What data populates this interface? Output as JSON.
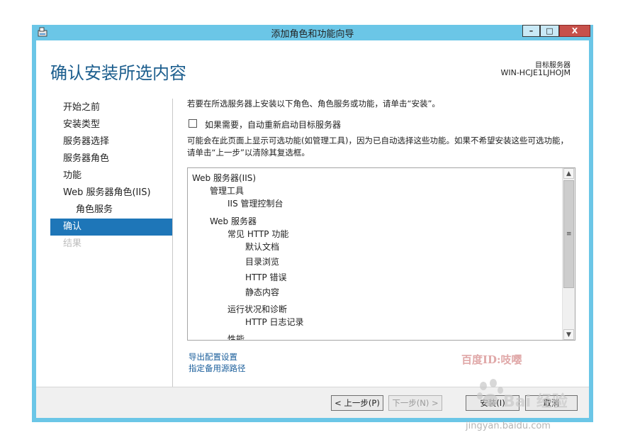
{
  "window": {
    "title": "添加角色和功能向导",
    "min_glyph": "–",
    "max_glyph": "□",
    "close_glyph": "X"
  },
  "header": {
    "page_title": "确认安装所选内容",
    "target_label": "目标服务器",
    "target_name": "WIN-HCJE1LJHOJM"
  },
  "nav": {
    "items": [
      {
        "label": "开始之前",
        "state": "normal"
      },
      {
        "label": "安装类型",
        "state": "normal"
      },
      {
        "label": "服务器选择",
        "state": "normal"
      },
      {
        "label": "服务器角色",
        "state": "normal"
      },
      {
        "label": "功能",
        "state": "normal"
      },
      {
        "label": "Web 服务器角色(IIS)",
        "state": "normal"
      },
      {
        "label": "角色服务",
        "state": "sub"
      },
      {
        "label": "确认",
        "state": "active"
      },
      {
        "label": "结果",
        "state": "disabled"
      }
    ]
  },
  "main": {
    "instruction": "若要在所选服务器上安装以下角色、角色服务或功能，请单击“安装”。",
    "restart_checkbox": {
      "label": "如果需要，自动重新启动目标服务器",
      "checked": false
    },
    "note": "可能会在此页面上显示可选功能(如管理工具)，因为已自动选择这些功能。如果不希望安装这些可选功能，请单击“上一步”以清除其复选框。",
    "tree": [
      {
        "label": "Web 服务器(IIS)",
        "level": 0
      },
      {
        "label": "管理工具",
        "level": 1
      },
      {
        "label": "IIS 管理控制台",
        "level": 2
      },
      {
        "label": "Web 服务器",
        "level": 1
      },
      {
        "label": "常见 HTTP 功能",
        "level": 2
      },
      {
        "label": "默认文档",
        "level": 3
      },
      {
        "label": "目录浏览",
        "level": 3
      },
      {
        "label": "HTTP 错误",
        "level": 3
      },
      {
        "label": "静态内容",
        "level": 3
      },
      {
        "label": "运行状况和诊断",
        "level": 2
      },
      {
        "label": "HTTP 日志记录",
        "level": 3
      },
      {
        "label": "性能",
        "level": 2
      }
    ],
    "links": {
      "export": "导出配置设置",
      "alt_source": "指定备用源路径"
    }
  },
  "footer": {
    "prev": "< 上一步(P)",
    "next": "下一步(N) >",
    "install": "安装(I)",
    "cancel": "取消"
  },
  "watermarks": {
    "baidu_id": "百度ID:吱嘤",
    "baidu_jingyan": "Bai 经验",
    "url": "jingyan.baidu.com"
  }
}
